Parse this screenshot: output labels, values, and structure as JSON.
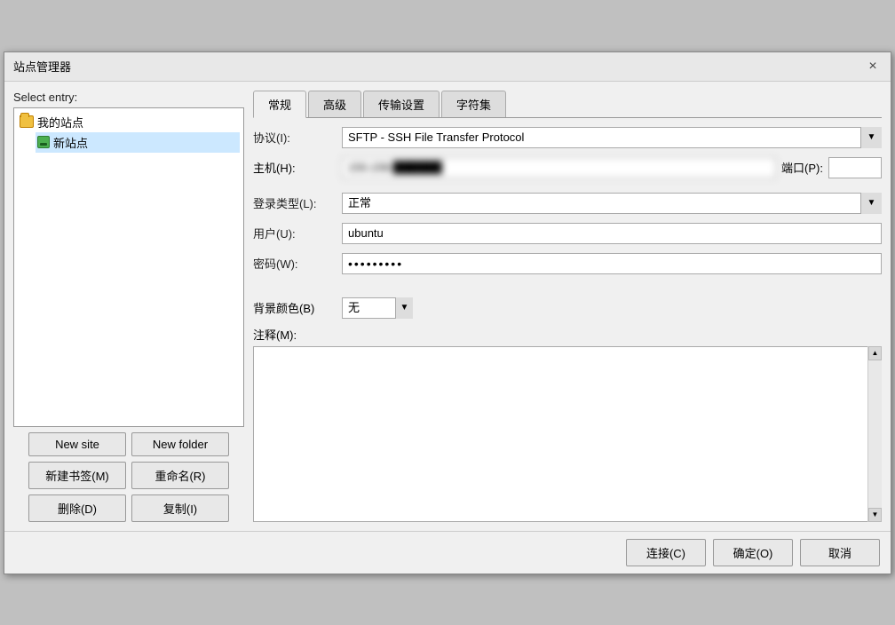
{
  "dialog": {
    "title": "站点管理器",
    "close_btn": "×"
  },
  "left": {
    "select_label": "Select entry:",
    "tree": {
      "root": {
        "label": "我的站点",
        "children": [
          {
            "label": "新站点"
          }
        ]
      }
    },
    "buttons": [
      {
        "id": "new-site",
        "label": "New site"
      },
      {
        "id": "new-folder",
        "label": "New folder"
      },
      {
        "id": "new-bookmark",
        "label": "新建书签(M)"
      },
      {
        "id": "rename",
        "label": "重命名(R)"
      },
      {
        "id": "delete",
        "label": "删除(D)"
      },
      {
        "id": "duplicate",
        "label": "复制(I)"
      }
    ]
  },
  "right": {
    "tabs": [
      {
        "id": "general",
        "label": "常规",
        "active": true
      },
      {
        "id": "advanced",
        "label": "高级"
      },
      {
        "id": "transfer",
        "label": "传输设置"
      },
      {
        "id": "charset",
        "label": "字符集"
      }
    ],
    "form": {
      "protocol_label": "协议(I):",
      "protocol_value": "SFTP - SSH File Transfer Protocol",
      "host_label": "主机(H):",
      "host_value": "150.158.██████",
      "port_label": "端口(P):",
      "port_value": "",
      "logon_type_label": "登录类型(L):",
      "logon_type_value": "正常",
      "user_label": "用户(U):",
      "user_value": "ubuntu",
      "password_label": "密码(W):",
      "password_value": "••••••••",
      "bg_color_label": "背景颜色(B)",
      "bg_color_value": "无",
      "notes_label": "注释(M):",
      "notes_value": ""
    }
  },
  "bottom": {
    "connect_btn": "连接(C)",
    "ok_btn": "确定(O)",
    "cancel_btn": "取消"
  }
}
